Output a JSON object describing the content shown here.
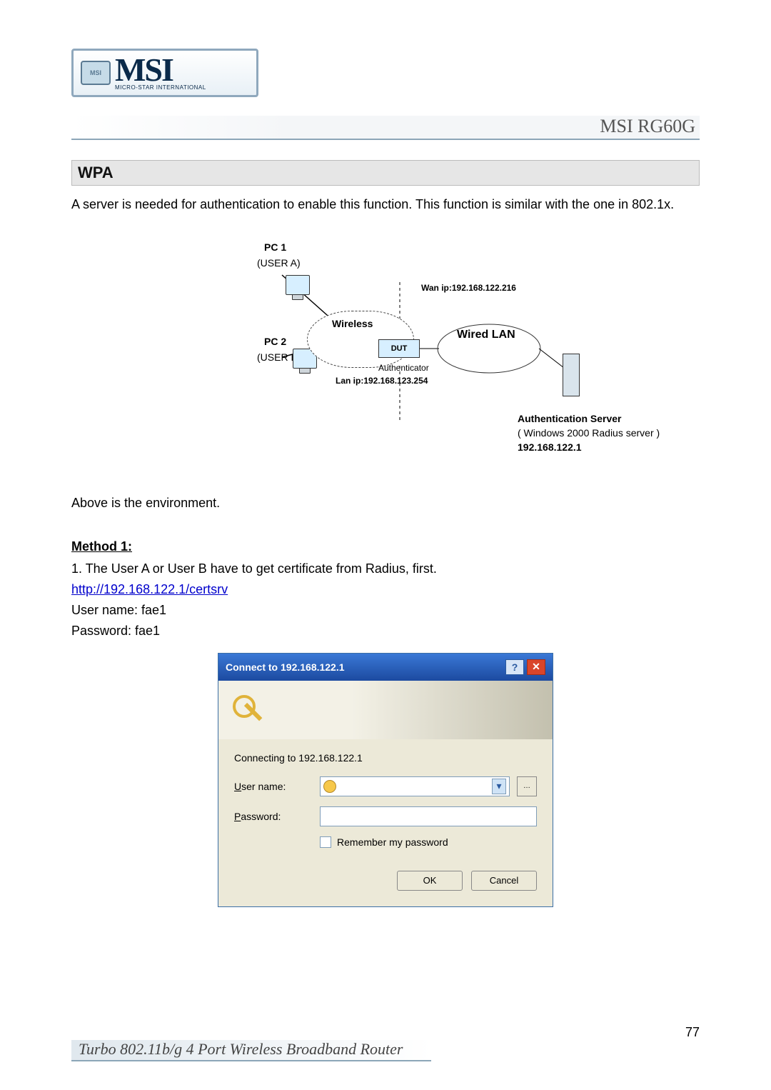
{
  "header": {
    "brand_text": "MSI",
    "brand_sub": "MICRO-STAR INTERNATIONAL",
    "badge_text": "MSI",
    "model": "MSI RG60G"
  },
  "section": {
    "title": "WPA",
    "intro": "A server is needed for authentication to enable this function. This function is similar with the one in 802.1x.",
    "env_caption": "Above is the environment."
  },
  "diagram": {
    "pc1": "PC 1",
    "user_a": "(USER A)",
    "pc2": "PC 2",
    "user_b": "(USER B)",
    "wireless": "Wireless",
    "wired_lan": "Wired  LAN",
    "wan_ip": "Wan ip:192.168.122.216",
    "lan_ip": "Lan ip:192.168.123.254",
    "dut": "DUT",
    "authenticator": "Authenticator",
    "auth_server_title": "Authentication Server",
    "auth_server_sub": "( Windows 2000 Radius server )",
    "auth_server_ip": "192.168.122.1"
  },
  "method": {
    "heading": "Method 1:",
    "step1": "1. The User A or User B have to get certificate from Radius, first.",
    "link": "http://192.168.122.1/certsrv",
    "username_line": "User name: fae1",
    "password_line": "Password: fae1"
  },
  "dialog": {
    "title": "Connect to 192.168.122.1",
    "connecting": "Connecting to 192.168.122.1",
    "label_user_prefix": "U",
    "label_user_rest": "ser name:",
    "label_pass_prefix": "P",
    "label_pass_rest": "assword:",
    "remember_prefix": "R",
    "remember_rest": "emember my password",
    "ok": "OK",
    "cancel": "Cancel",
    "user_value": "",
    "pass_value": ""
  },
  "footer": {
    "title": "Turbo 802.11b/g 4 Port Wireless Broadband Router",
    "page": "77"
  }
}
